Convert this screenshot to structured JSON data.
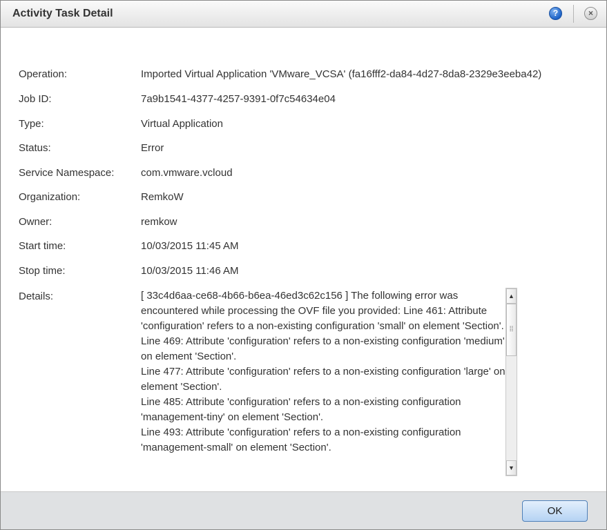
{
  "dialog": {
    "title": "Activity Task Detail",
    "help_glyph": "?",
    "close_glyph": "×"
  },
  "fields": [
    {
      "label": "Operation:",
      "value": "Imported Virtual Application 'VMware_VCSA' (fa16fff2-da84-4d27-8da8-2329e3eeba42)"
    },
    {
      "label": "Job ID:",
      "value": "7a9b1541-4377-4257-9391-0f7c54634e04"
    },
    {
      "label": "Type:",
      "value": "Virtual Application"
    },
    {
      "label": "Status:",
      "value": "Error"
    },
    {
      "label": "Service Namespace:",
      "value": "com.vmware.vcloud"
    },
    {
      "label": "Organization:",
      "value": "RemkoW"
    },
    {
      "label": "Owner:",
      "value": "remkow"
    },
    {
      "label": "Start time:",
      "value": "10/03/2015 11:45 AM"
    },
    {
      "label": "Stop time:",
      "value": "10/03/2015 11:46 AM"
    }
  ],
  "details": {
    "label": "Details:",
    "text": "[ 33c4d6aa-ce68-4b66-b6ea-46ed3c62c156 ] The following error was encountered while processing the OVF file you provided: Line 461: Attribute 'configuration' refers to a non-existing configuration 'small' on element 'Section'.\nLine 469: Attribute 'configuration' refers to a non-existing configuration 'medium' on element 'Section'.\nLine 477: Attribute 'configuration' refers to a non-existing configuration 'large' on element 'Section'.\nLine 485: Attribute 'configuration' refers to a non-existing configuration 'management-tiny' on element 'Section'.\nLine 493: Attribute 'configuration' refers to a non-existing configuration 'management-small' on element 'Section'."
  },
  "footer": {
    "ok_label": "OK"
  },
  "icons": {
    "help": "help-icon",
    "close": "close-icon",
    "scroll_up": "scroll-up-arrow-icon",
    "scroll_down": "scroll-down-arrow-icon",
    "grip": "scroll-grip-icon"
  },
  "colors": {
    "help_blue": "#1e64c8",
    "ok_button": "#b5d3f3",
    "footer_bg": "#dfe1e3"
  }
}
